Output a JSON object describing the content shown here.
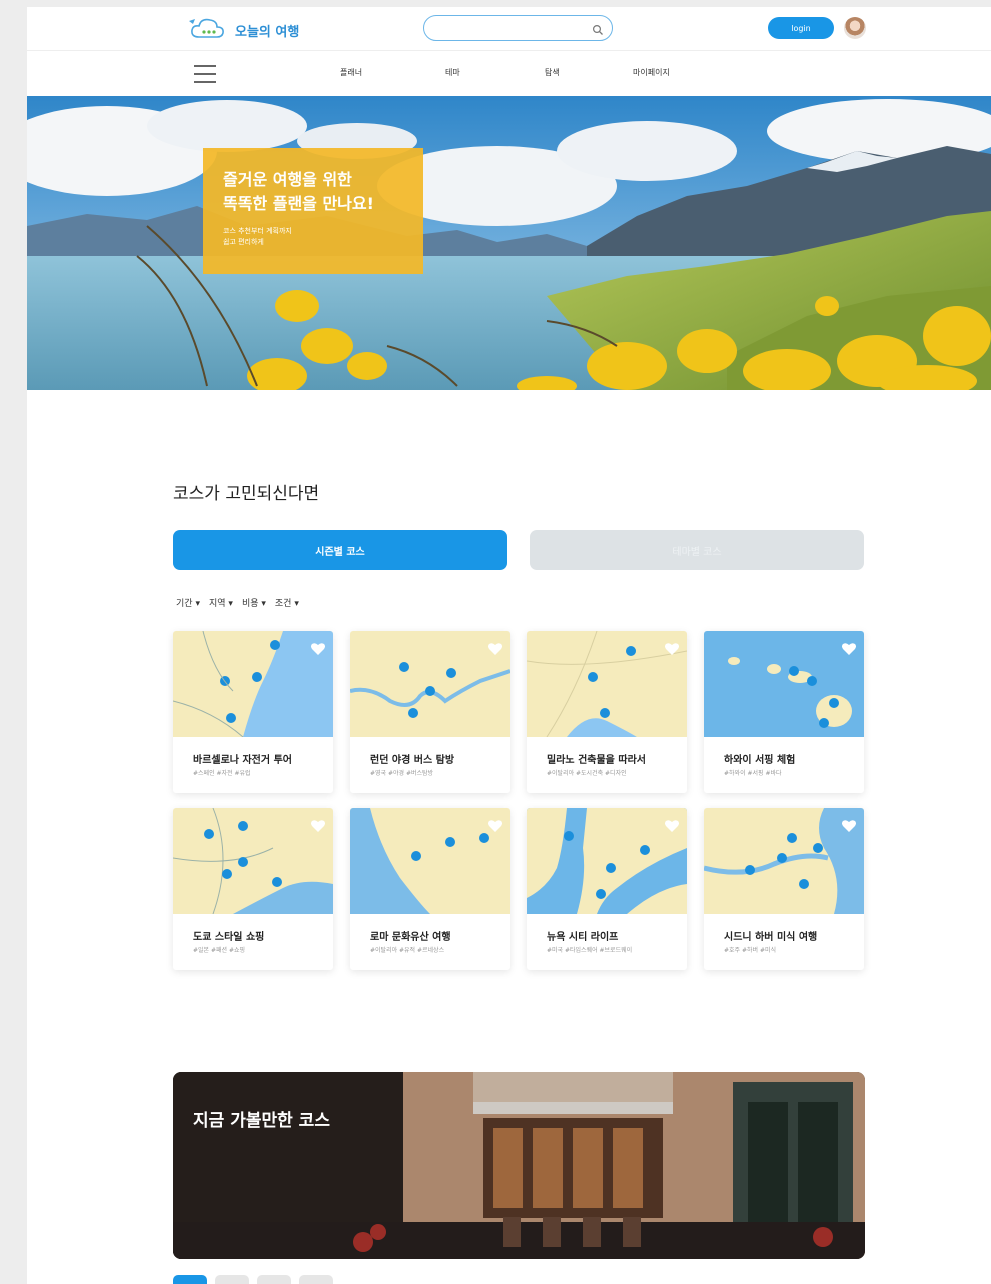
{
  "header": {
    "logo_text": "오늘의 여행",
    "search_placeholder": "",
    "login_label": "login"
  },
  "nav": {
    "items": [
      "플래너",
      "테마",
      "탐색",
      "마이페이지"
    ]
  },
  "hero": {
    "promo_title_line1": "즐거운 여행을 위한",
    "promo_title_line2": "똑똑한 플랜을 만나요!",
    "promo_sub_line1": "코스 추천부터 계획까지",
    "promo_sub_line2": "쉽고 편리하게"
  },
  "courses": {
    "section_title": "코스가 고민되신다면",
    "tab_primary": "시즌별 코스",
    "tab_secondary": "테마별 코스",
    "filters": [
      "기간",
      "지역",
      "비용",
      "조건"
    ],
    "cards": [
      {
        "title": "바르셀로나 자전거 투어",
        "tags": "#스페인  #자전  #유럽"
      },
      {
        "title": "런던 야경 버스 탐방",
        "tags": "#영국  #야경  #버스탐방"
      },
      {
        "title": "밀라노 건축물을 따라서",
        "tags": "#이탈리아  #도시건축  #디자인"
      },
      {
        "title": "하와이 서핑 체험",
        "tags": "#하와이  #서핑  #바다"
      },
      {
        "title": "도쿄 스타일 쇼핑",
        "tags": "#일본  #패션  #쇼핑"
      },
      {
        "title": "로마 문화유산 여행",
        "tags": "#이탈리아  #유적  #르네상스"
      },
      {
        "title": "뉴욕 시티 라이프",
        "tags": "#미국  #타임스퀘어  #브로드웨이"
      },
      {
        "title": "시드니 하버 미식 여행",
        "tags": "#호주  #하버  #미식"
      }
    ]
  },
  "now_course": {
    "title": "지금 가볼만한 코스"
  },
  "colors": {
    "accent": "#1996e6",
    "promo": "#f3b828",
    "map_land": "#f5ebbc",
    "map_water": "#6cb6e8",
    "pin": "#1b8fdb"
  }
}
